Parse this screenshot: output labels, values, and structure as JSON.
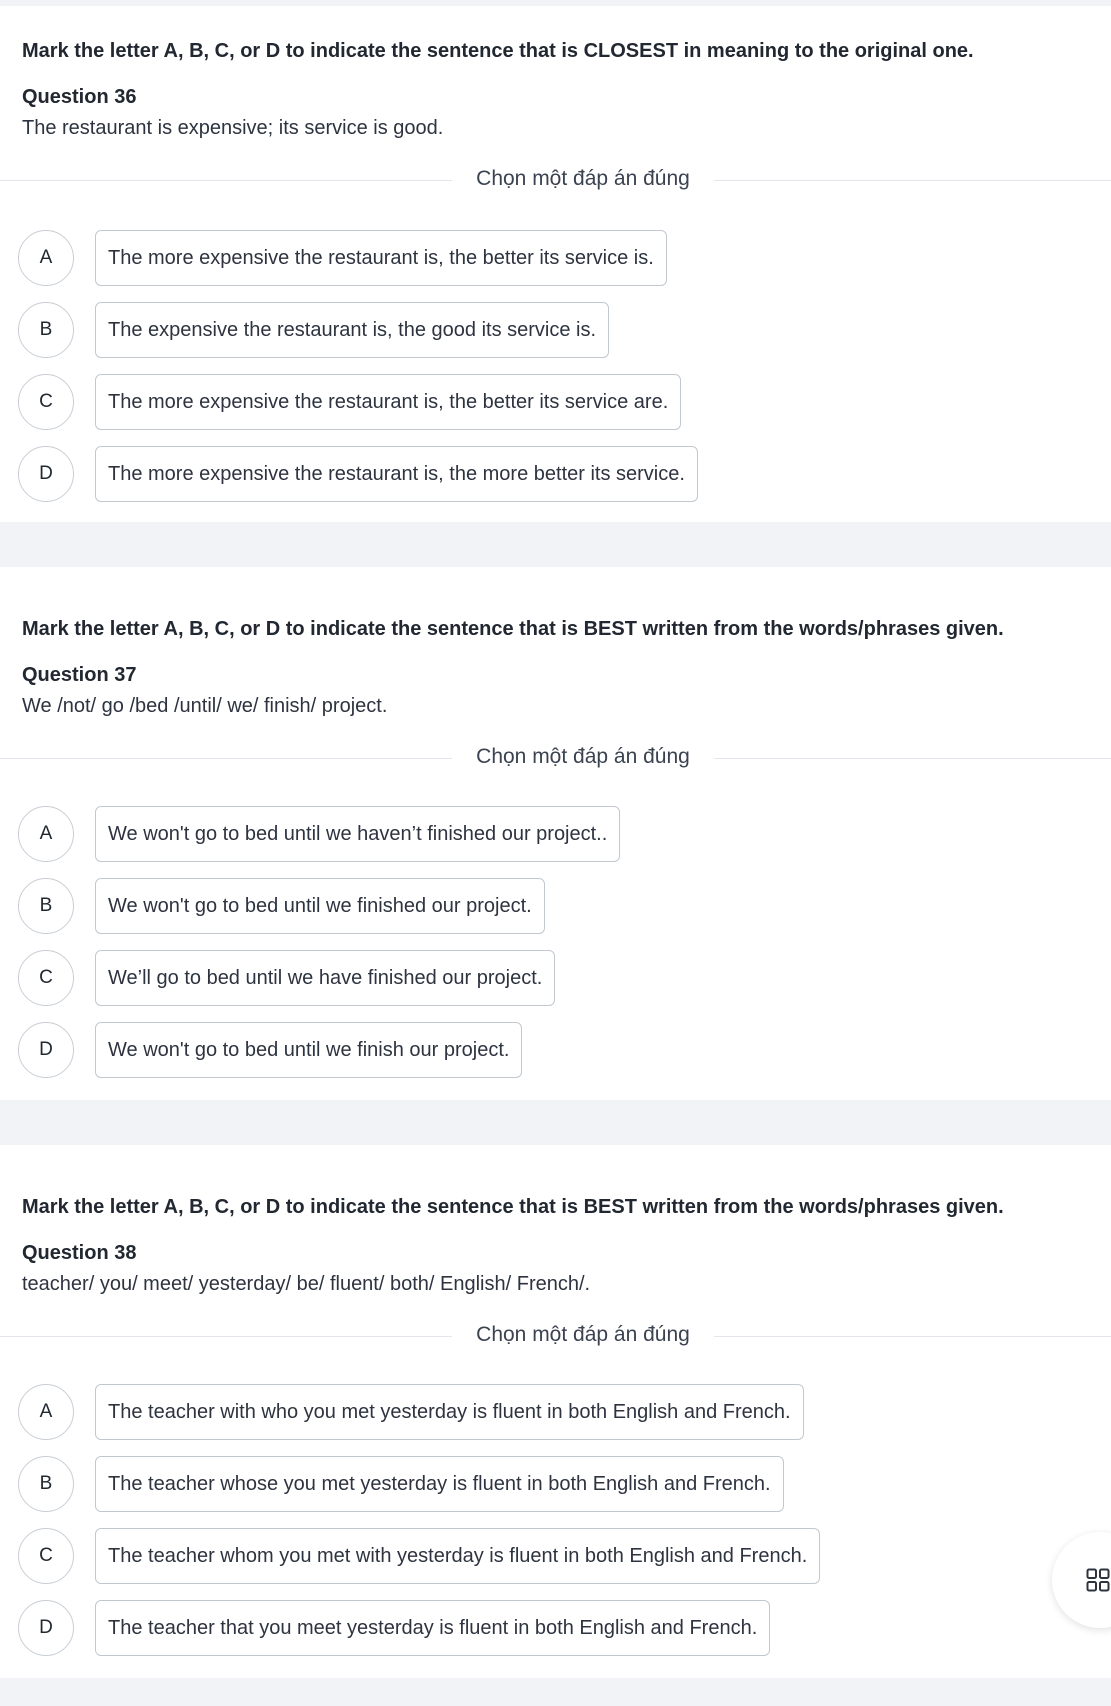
{
  "selector_label": "Chọn một đáp án đúng",
  "questions": [
    {
      "instruction": "Mark the letter A, B, C, or D to indicate the sentence that is CLOSEST in meaning to the original one.",
      "number": "Question 36",
      "prompt": "The restaurant is expensive; its service is good.",
      "options": [
        {
          "letter": "A",
          "text": "The more expensive the restaurant is, the better its service is."
        },
        {
          "letter": "B",
          "text": "The expensive the restaurant is, the good its service is."
        },
        {
          "letter": "C",
          "text": "The more expensive the restaurant is, the better its service are."
        },
        {
          "letter": "D",
          "text": "The more expensive the restaurant is, the more better its service."
        }
      ]
    },
    {
      "instruction": "Mark the letter A, B, C, or D to indicate the sentence that is BEST written from the words/phrases given.",
      "number": "Question 37",
      "prompt": "We /not/ go /bed /until/ we/ finish/ project.",
      "options": [
        {
          "letter": "A",
          "text": "We won't go to bed until we haven’t finished our project.."
        },
        {
          "letter": "B",
          "text": "We won't go to bed until we finished our project."
        },
        {
          "letter": "C",
          "text": "We’ll go to bed until we have finished our project."
        },
        {
          "letter": "D",
          "text": "We won't go to bed until we finish our project."
        }
      ]
    },
    {
      "instruction": "Mark the letter A, B, C, or D to indicate the sentence that is BEST written from the words/phrases given.",
      "number": "Question 38",
      "prompt": "teacher/ you/ meet/ yesterday/ be/ fluent/ both/ English/ French/.",
      "options": [
        {
          "letter": "A",
          "text": "The teacher with who you met yesterday is fluent in both English and French."
        },
        {
          "letter": "B",
          "text": "The teacher whose you met yesterday is fluent in both English and French."
        },
        {
          "letter": "C",
          "text": "The teacher whom you met with yesterday is fluent in both English and French."
        },
        {
          "letter": "D",
          "text": "The teacher that you meet yesterday is fluent in both English and French."
        }
      ]
    }
  ],
  "fab_icon": "grid-icon"
}
